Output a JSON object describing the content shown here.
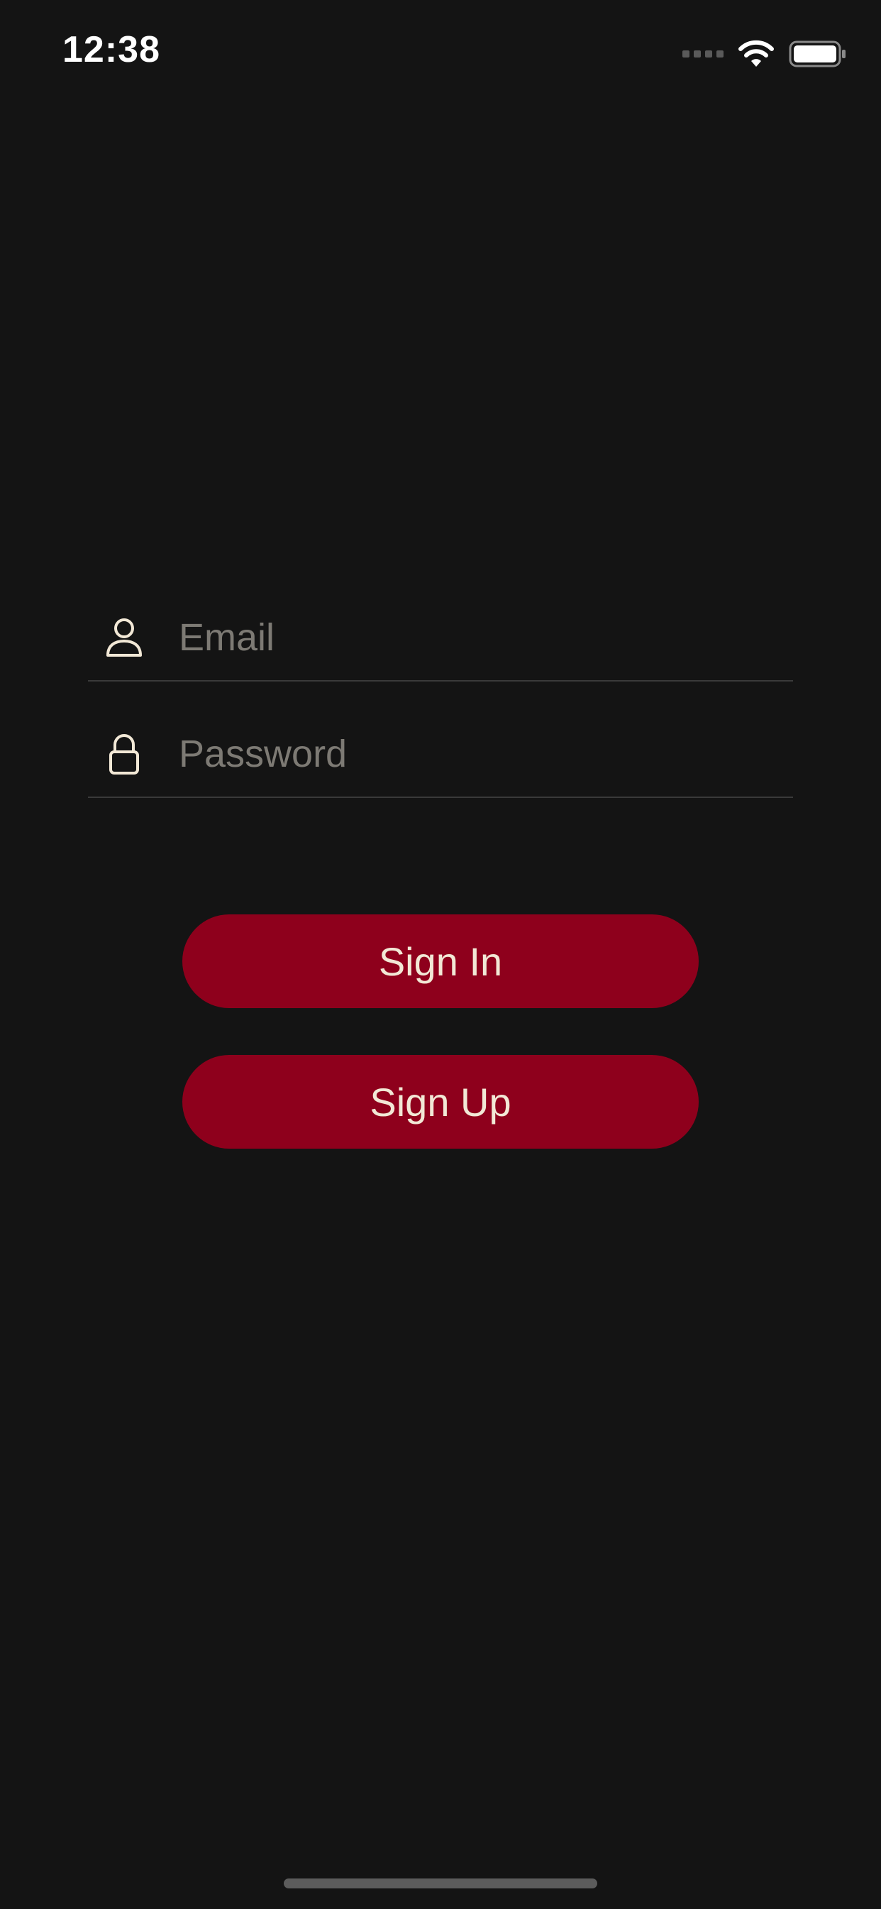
{
  "status_bar": {
    "time": "12:38"
  },
  "login_form": {
    "email_placeholder": "Email",
    "password_placeholder": "Password",
    "email_icon": "person-icon",
    "password_icon": "lock-icon"
  },
  "actions": {
    "sign_in_label": "Sign In",
    "sign_up_label": "Sign Up"
  },
  "colors": {
    "background": "#141414",
    "button": "#8e001c",
    "button_text": "#f2e8d6",
    "icon": "#f2e8d6",
    "placeholder": "#7d7a74"
  }
}
